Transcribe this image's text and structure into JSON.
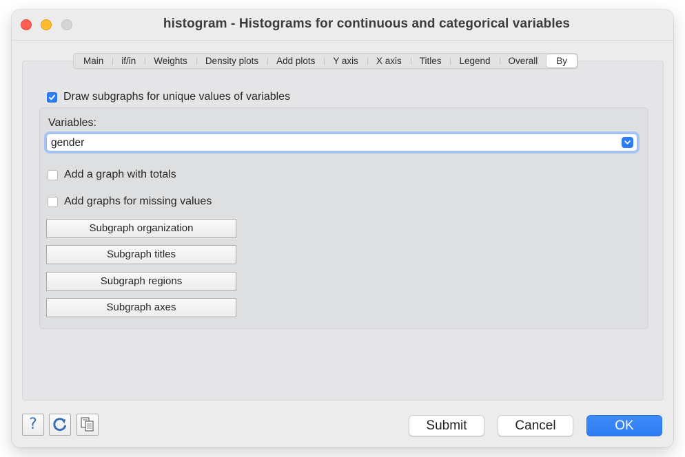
{
  "window": {
    "title": "histogram - Histograms for continuous and categorical variables"
  },
  "tabs": [
    {
      "label": "Main"
    },
    {
      "label": "if/in"
    },
    {
      "label": "Weights"
    },
    {
      "label": "Density plots"
    },
    {
      "label": "Add plots"
    },
    {
      "label": "Y axis"
    },
    {
      "label": "X axis"
    },
    {
      "label": "Titles"
    },
    {
      "label": "Legend"
    },
    {
      "label": "Overall"
    },
    {
      "label": "By"
    }
  ],
  "active_tab": "By",
  "by": {
    "draw_subgraphs": {
      "label": "Draw subgraphs for unique values of variables",
      "checked": true
    },
    "variables_label": "Variables:",
    "variables_value": "gender",
    "add_totals": {
      "label": "Add a graph with totals",
      "checked": false
    },
    "add_missing": {
      "label": "Add graphs for missing values",
      "checked": false
    },
    "buttons": {
      "organization": "Subgraph organization",
      "titles": "Subgraph titles",
      "regions": "Subgraph regions",
      "axes": "Subgraph axes"
    }
  },
  "footer": {
    "help_icon": "?",
    "reset_icon": "reset-icon",
    "copy_icon": "copy-icon",
    "submit": "Submit",
    "cancel": "Cancel",
    "ok": "OK"
  },
  "colors": {
    "accent": "#2f7df6",
    "close": "#fe5f57",
    "minimize": "#febc2e",
    "zoom_disabled": "#d5d5d5"
  }
}
